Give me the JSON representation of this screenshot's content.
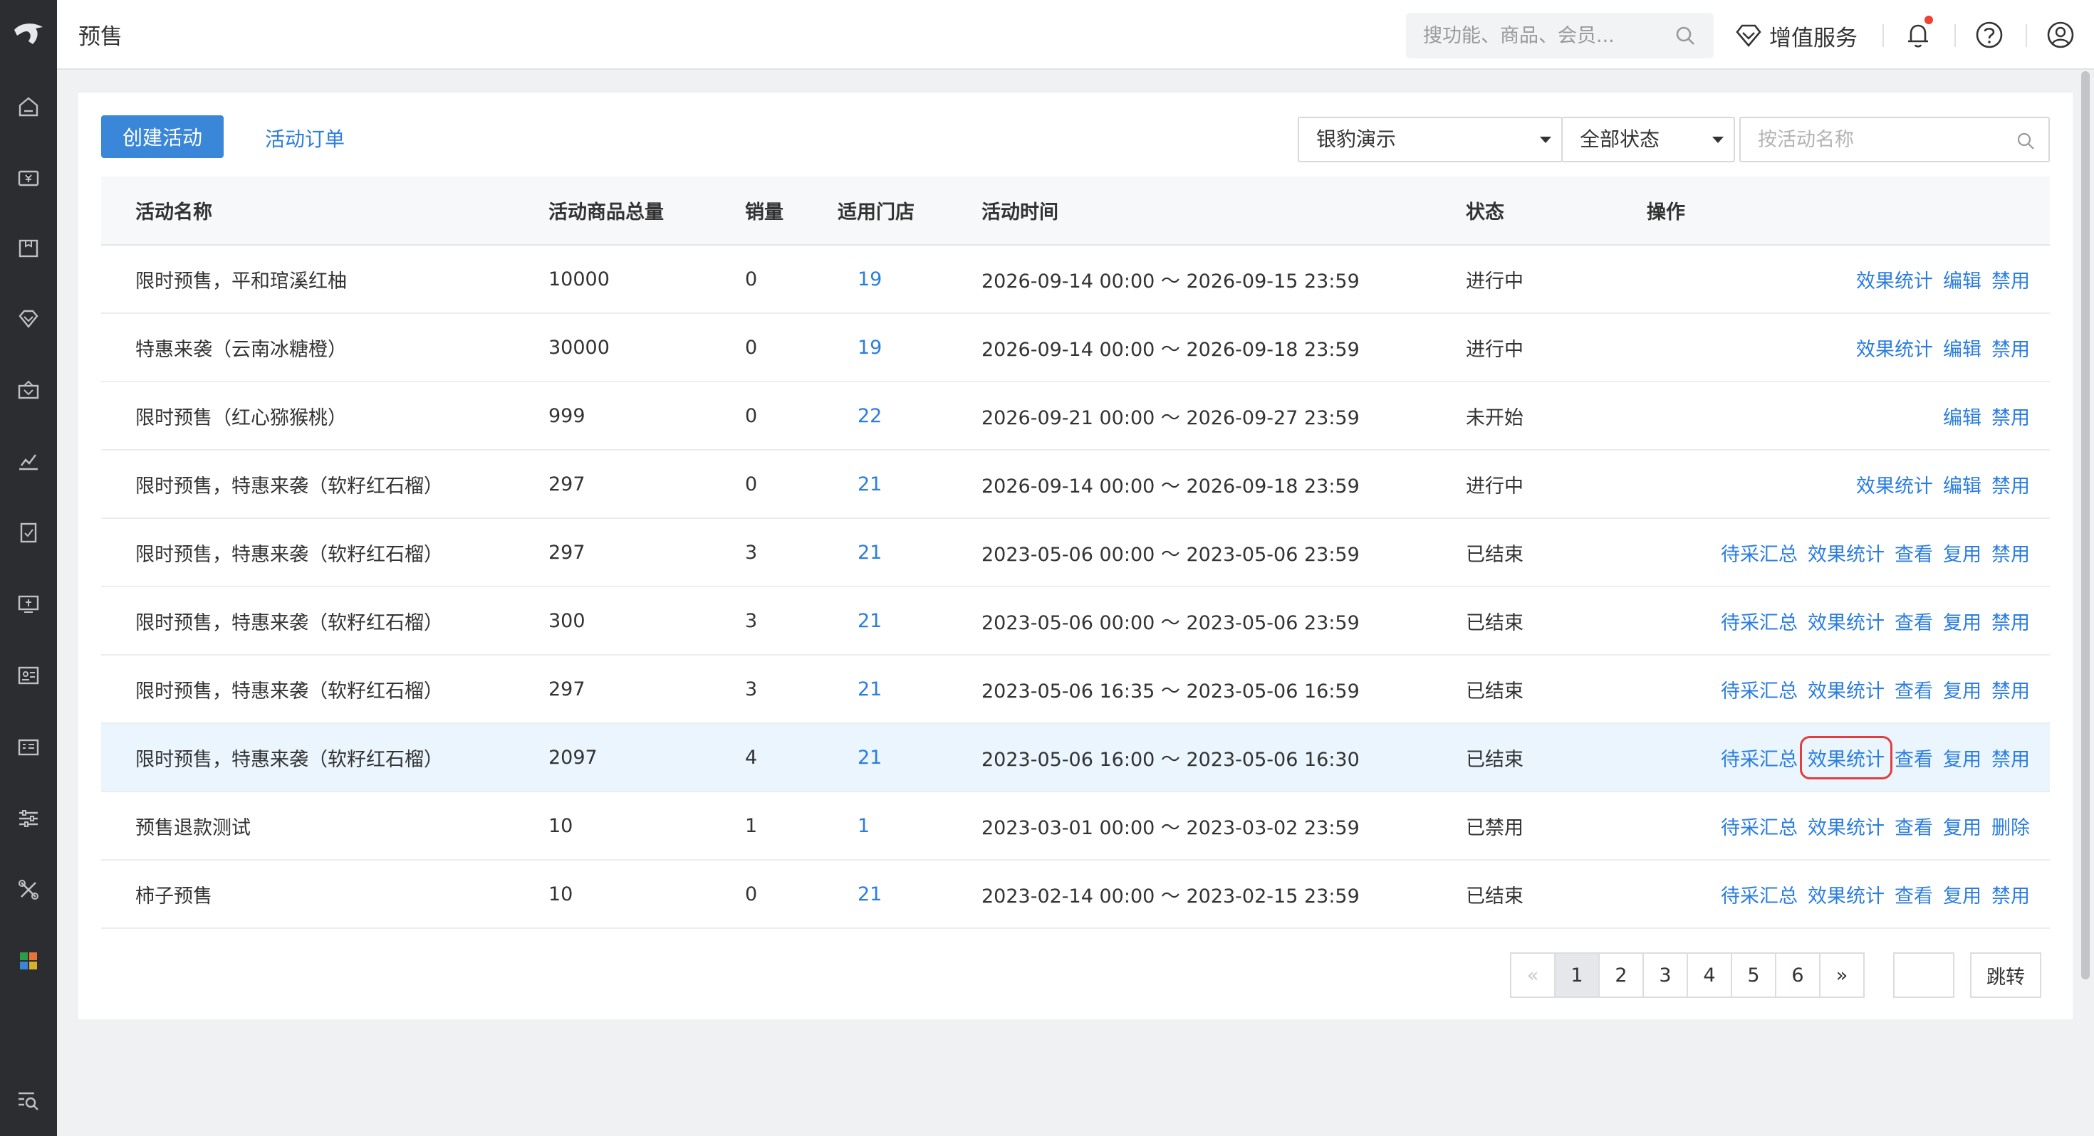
{
  "header": {
    "title": "预售",
    "search_placeholder": "搜功能、商品、会员...",
    "value_added": "增值服务"
  },
  "sidebar": {
    "icons": [
      "logo-icon",
      "home-icon",
      "cashier-icon",
      "goods-icon",
      "membership-icon",
      "marketing-icon",
      "analytics-icon",
      "orders-icon",
      "finance-icon",
      "staff-icon",
      "screen-icon",
      "settings-icon",
      "tools-icon",
      "apps-icon",
      "search-menu-icon"
    ]
  },
  "toolbar": {
    "create_label": "创建活动",
    "orders_label": "活动订单",
    "store_select": "银豹演示",
    "status_select": "全部状态",
    "name_search_placeholder": "按活动名称"
  },
  "table": {
    "headers": {
      "name": "活动名称",
      "total": "活动商品总量",
      "sales": "销量",
      "stores": "适用门店",
      "time": "活动时间",
      "status": "状态",
      "ops": "操作"
    },
    "rows": [
      {
        "name": "限时预售，平和琯溪红柚",
        "total": "10000",
        "sales": "0",
        "stores": "19",
        "time": "2026-09-14 00:00 ～ 2026-09-15 23:59",
        "status": "进行中",
        "ops": [
          "效果统计",
          "编辑",
          "禁用"
        ]
      },
      {
        "name": "特惠来袭（云南冰糖橙）",
        "total": "30000",
        "sales": "0",
        "stores": "19",
        "time": "2026-09-14 00:00 ～ 2026-09-18 23:59",
        "status": "进行中",
        "ops": [
          "效果统计",
          "编辑",
          "禁用"
        ]
      },
      {
        "name": "限时预售（红心猕猴桃）",
        "total": "999",
        "sales": "0",
        "stores": "22",
        "time": "2026-09-21 00:00 ～ 2026-09-27 23:59",
        "status": "未开始",
        "ops": [
          "编辑",
          "禁用"
        ]
      },
      {
        "name": "限时预售，特惠来袭（软籽红石榴）",
        "total": "297",
        "sales": "0",
        "stores": "21",
        "time": "2026-09-14 00:00 ～ 2026-09-18 23:59",
        "status": "进行中",
        "ops": [
          "效果统计",
          "编辑",
          "禁用"
        ]
      },
      {
        "name": "限时预售，特惠来袭（软籽红石榴）",
        "total": "297",
        "sales": "3",
        "stores": "21",
        "time": "2023-05-06 00:00 ～ 2023-05-06 23:59",
        "status": "已结束",
        "ops": [
          "待采汇总",
          "效果统计",
          "查看",
          "复用",
          "禁用"
        ]
      },
      {
        "name": "限时预售，特惠来袭（软籽红石榴）",
        "total": "300",
        "sales": "3",
        "stores": "21",
        "time": "2023-05-06 00:00 ～ 2023-05-06 23:59",
        "status": "已结束",
        "ops": [
          "待采汇总",
          "效果统计",
          "查看",
          "复用",
          "禁用"
        ]
      },
      {
        "name": "限时预售，特惠来袭（软籽红石榴）",
        "total": "297",
        "sales": "3",
        "stores": "21",
        "time": "2023-05-06 16:35 ～ 2023-05-06 16:59",
        "status": "已结束",
        "ops": [
          "待采汇总",
          "效果统计",
          "查看",
          "复用",
          "禁用"
        ]
      },
      {
        "name": "限时预售，特惠来袭（软籽红石榴）",
        "total": "2097",
        "sales": "4",
        "stores": "21",
        "time": "2023-05-06 16:00 ～ 2023-05-06 16:30",
        "status": "已结束",
        "ops": [
          "待采汇总",
          "效果统计",
          "查看",
          "复用",
          "禁用"
        ]
      },
      {
        "name": "预售退款测试",
        "total": "10",
        "sales": "1",
        "stores": "1",
        "time": "2023-03-01 00:00 ～ 2023-03-02 23:59",
        "status": "已禁用",
        "ops": [
          "待采汇总",
          "效果统计",
          "查看",
          "复用",
          "删除"
        ]
      },
      {
        "name": "柿子预售",
        "total": "10",
        "sales": "0",
        "stores": "21",
        "time": "2023-02-14 00:00 ～ 2023-02-15 23:59",
        "status": "已结束",
        "ops": [
          "待采汇总",
          "效果统计",
          "查看",
          "复用",
          "禁用"
        ]
      }
    ]
  },
  "pagination": {
    "prev": "«",
    "pages": [
      "1",
      "2",
      "3",
      "4",
      "5",
      "6"
    ],
    "next": "»",
    "current": "1",
    "jump_label": "跳转"
  },
  "colors": {
    "primary": "#3a86d8",
    "link": "#2b7de0",
    "highlight_row": "#eaf5fd",
    "sidebar_bg": "#2b2d31",
    "focus_outline": "#e43d3d"
  }
}
